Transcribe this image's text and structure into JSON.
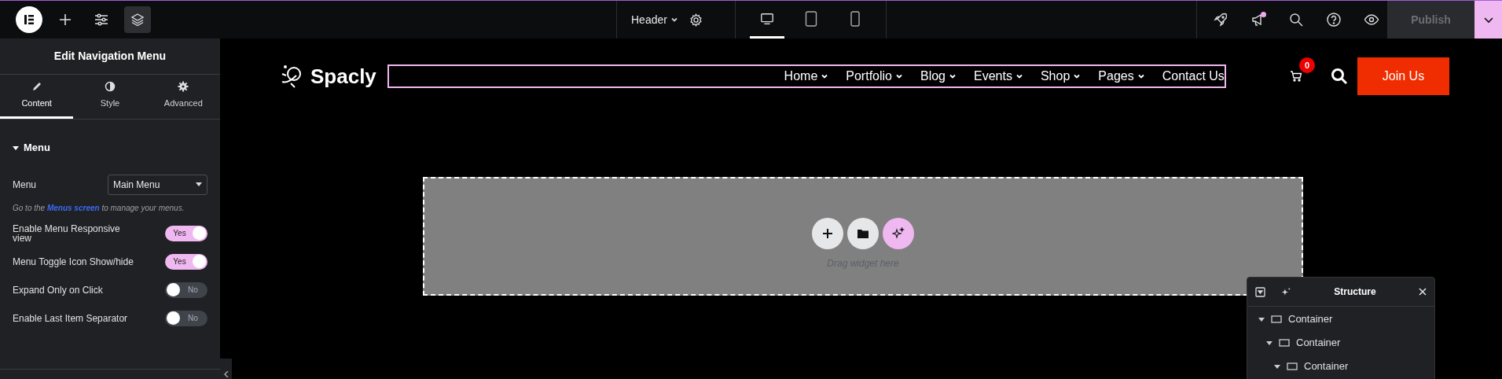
{
  "topbar": {
    "tools": [
      {
        "kind": "logo",
        "selected": false
      },
      {
        "kind": "add",
        "selected": false
      },
      {
        "kind": "settings",
        "selected": false
      },
      {
        "kind": "layers",
        "selected": true
      }
    ],
    "document": {
      "title": "Header"
    },
    "devices": [
      {
        "kind": "desktop",
        "selected": true
      },
      {
        "kind": "tablet",
        "selected": false
      },
      {
        "kind": "mobile",
        "selected": false
      }
    ],
    "actions": [
      {
        "kind": "rocket",
        "badge": false
      },
      {
        "kind": "announcements",
        "badge": true
      },
      {
        "kind": "search",
        "badge": false
      },
      {
        "kind": "help",
        "badge": false
      },
      {
        "kind": "preview",
        "badge": false
      }
    ],
    "publish": {
      "label": "Publish",
      "disabled": true
    }
  },
  "panel": {
    "title": "Edit Navigation Menu",
    "tabs": [
      {
        "label": "Content",
        "kind": "content",
        "selected": true
      },
      {
        "label": "Style",
        "kind": "style",
        "selected": false
      },
      {
        "label": "Advanced",
        "kind": "advanced",
        "selected": false
      }
    ],
    "section": {
      "title": "Menu",
      "expanded": true
    },
    "menu_select": {
      "label": "Menu",
      "value": "Main Menu"
    },
    "hint": "Go to the ",
    "hint_link": "Menus screen",
    "hint_end": " to manage your menus.",
    "toggles": [
      {
        "label": "Enable Menu Responsive view",
        "on": true,
        "text": "Yes"
      },
      {
        "label": "Menu Toggle Icon Show/hide",
        "on": true,
        "text": "Yes"
      },
      {
        "label": "Expand Only on Click",
        "on": false,
        "text": "No"
      },
      {
        "label": "Enable Last Item Separator",
        "on": false,
        "text": "No"
      }
    ]
  },
  "canvas": {
    "logo": "Spacly",
    "nav": [
      "Home",
      "Portfolio",
      "Blog",
      "Events",
      "Shop",
      "Pages",
      "Contact Us"
    ],
    "cart_count": "0",
    "cta": "Join Us",
    "drop_zone": {
      "hint": "Drag widget here"
    }
  },
  "structure": {
    "title": "Structure",
    "tree": [
      {
        "label": "Container",
        "expanded": true,
        "children": [
          {
            "label": "Container",
            "expanded": true,
            "children": [
              {
                "label": "Container",
                "expanded": true
              }
            ]
          }
        ]
      }
    ]
  }
}
